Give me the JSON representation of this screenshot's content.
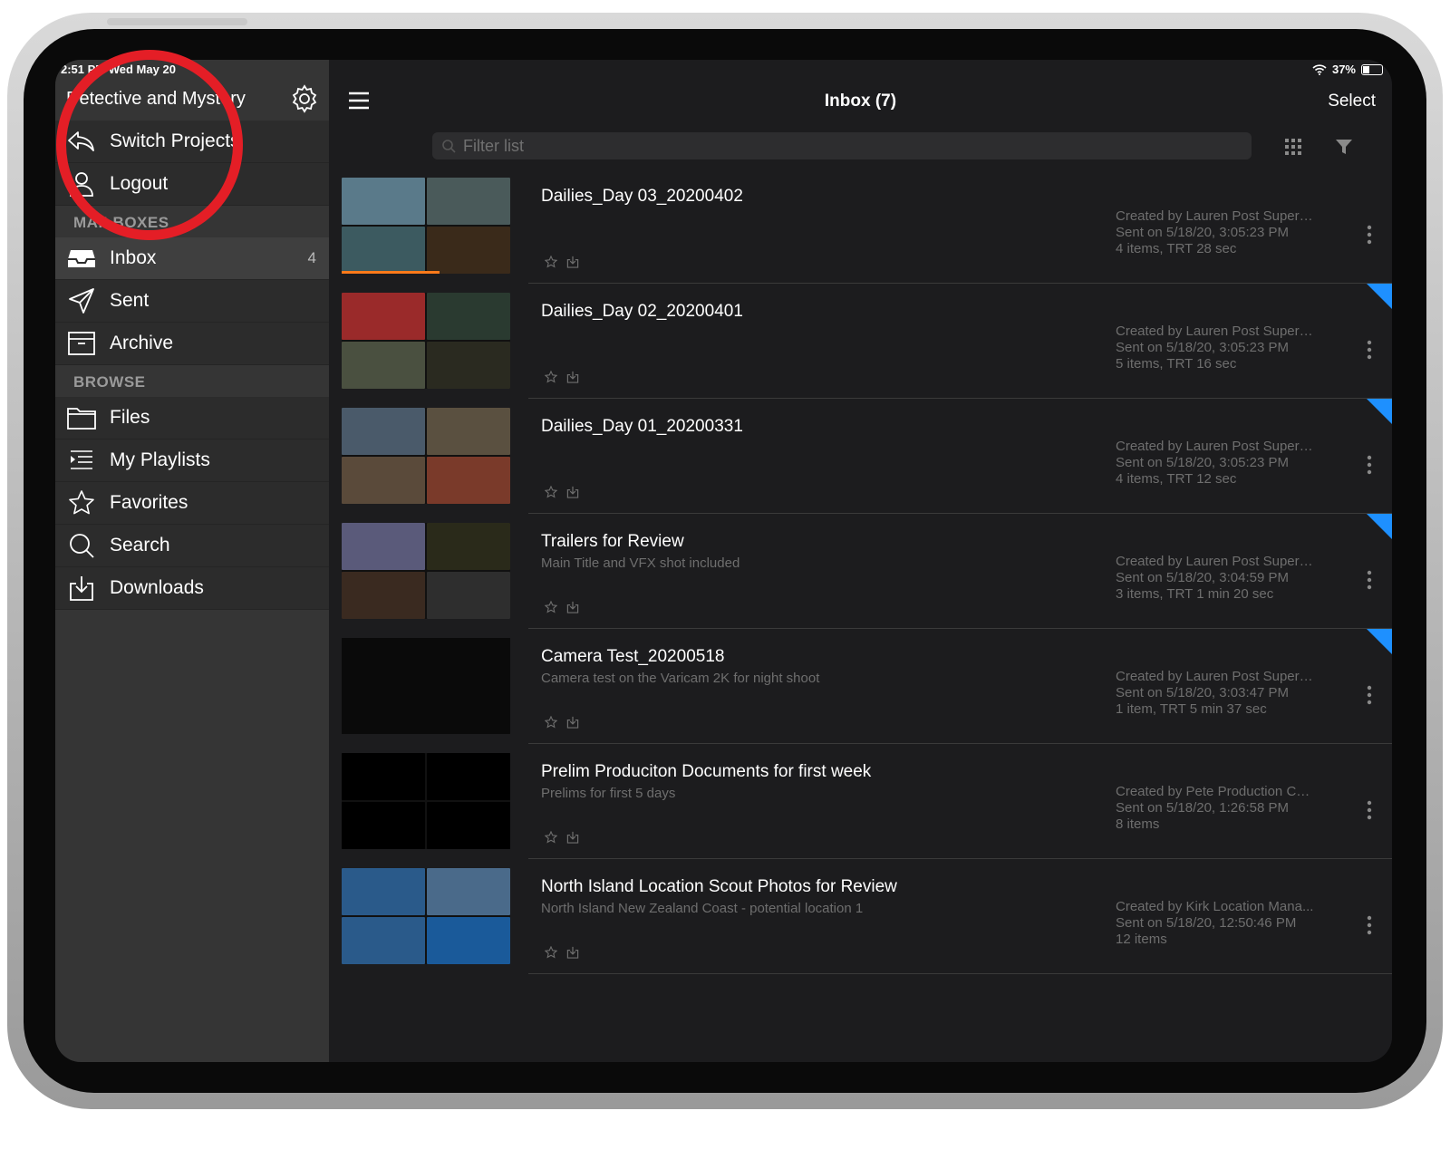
{
  "status": {
    "time": "2:51 PM  Wed May 20",
    "battery": "37%"
  },
  "sidebar": {
    "project_title": "Detective and Mystery",
    "items_top": [
      {
        "label": "Switch Projects",
        "icon": "switch-arrow-icon"
      },
      {
        "label": "Logout",
        "icon": "user-icon"
      }
    ],
    "mailboxes_title": "MAILBOXES",
    "mailboxes": [
      {
        "label": "Inbox",
        "count": "4",
        "icon": "inbox-tray-icon"
      },
      {
        "label": "Sent",
        "icon": "paper-plane-icon"
      },
      {
        "label": "Archive",
        "icon": "archive-box-icon"
      }
    ],
    "browse_title": "BROWSE",
    "browse": [
      {
        "label": "Files",
        "icon": "folder-icon"
      },
      {
        "label": "My Playlists",
        "icon": "playlist-icon"
      },
      {
        "label": "Favorites",
        "icon": "star-icon"
      },
      {
        "label": "Search",
        "icon": "search-icon"
      },
      {
        "label": "Downloads",
        "icon": "download-icon"
      }
    ]
  },
  "header": {
    "title": "Inbox (7)",
    "select_label": "Select"
  },
  "filter": {
    "placeholder": "Filter list"
  },
  "items": [
    {
      "name": "Dailies_Day 03_20200402",
      "desc": "",
      "created": "Created by Lauren Post Superv...",
      "sent": "Sent on 5/18/20, 3:05:23 PM",
      "info": "4 items, TRT 28 sec",
      "flag": false,
      "progress": 0.58
    },
    {
      "name": "Dailies_Day 02_20200401",
      "desc": "",
      "created": "Created by Lauren Post Superv...",
      "sent": "Sent on 5/18/20, 3:05:23 PM",
      "info": "5 items, TRT 16 sec",
      "flag": true
    },
    {
      "name": "Dailies_Day 01_20200331",
      "desc": "",
      "created": "Created by Lauren Post Superv...",
      "sent": "Sent on 5/18/20, 3:05:23 PM",
      "info": "4 items, TRT 12 sec",
      "flag": true
    },
    {
      "name": "Trailers for Review",
      "desc": "Main Title and VFX shot included",
      "created": "Created by Lauren Post Superv...",
      "sent": "Sent on 5/18/20, 3:04:59 PM",
      "info": "3 items, TRT 1 min 20 sec",
      "flag": true
    },
    {
      "name": "Camera Test_20200518",
      "desc": "Camera test on the Varicam 2K for night shoot",
      "created": "Created by Lauren Post Superv...",
      "sent": "Sent on 5/18/20, 3:03:47 PM",
      "info": "1 item, TRT 5 min 37 sec",
      "flag": true
    },
    {
      "name": "Prelim Produciton Documents for first week",
      "desc": "Prelims for first 5 days",
      "created": "Created by Pete Production Co...",
      "sent": "Sent on 5/18/20, 1:26:58 PM",
      "info": "8 items",
      "flag": false
    },
    {
      "name": "North Island Location Scout Photos for Review",
      "desc": "North Island New Zealand Coast - potential location 1",
      "created": "Created by Kirk Location Mana...",
      "sent": "Sent on 5/18/20, 12:50:46 PM",
      "info": "12 items",
      "flag": false
    }
  ],
  "thumb_colors": [
    [
      "#5a7a8a",
      "#4a5a5a",
      "#3c5a60",
      "#3a2a1a"
    ],
    [
      "#9a2a2a",
      "#2a3a30",
      "#4a5040",
      "#2a2a20"
    ],
    [
      "#4a5a6a",
      "#5a5040",
      "#5a4a3a",
      "#7a3a2a"
    ],
    [
      "#5a5a7a",
      "#2a2a1a",
      "#3a2a20",
      "#2e2e2e"
    ],
    [
      "#0a0a0a"
    ],
    [
      "#000000",
      "#000000",
      "#000000",
      "#000000"
    ],
    [
      "#2a5a8a",
      "#4a6a8a",
      "#2a5a8a",
      "#1a5a9a"
    ]
  ],
  "accent_colors": {
    "flag": "#1e90ff",
    "progress": "#ff7a1a",
    "annotation_ring": "#e41e26"
  }
}
